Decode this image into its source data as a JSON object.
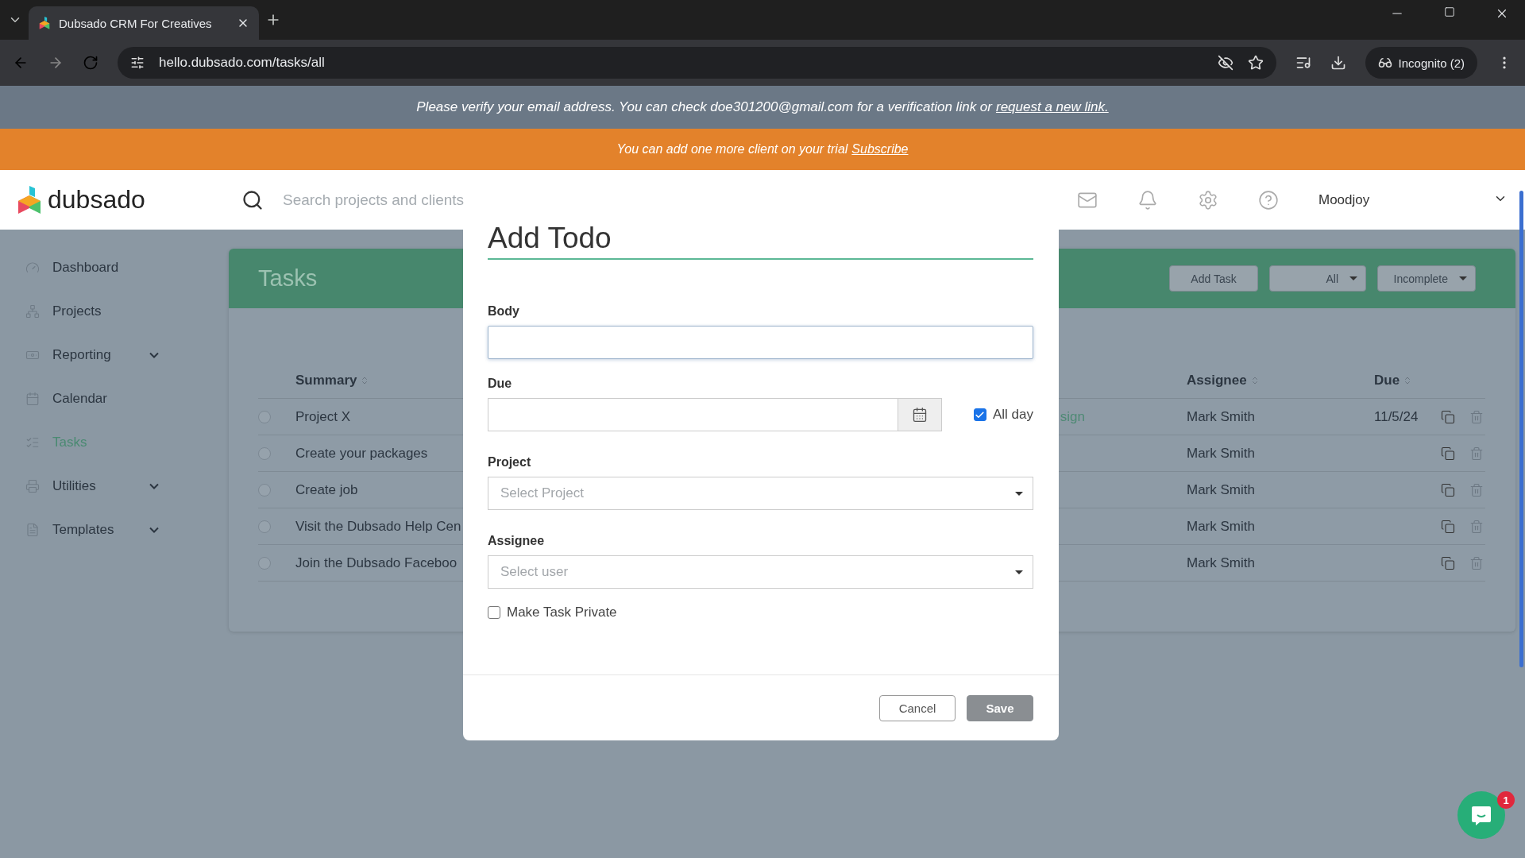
{
  "browser": {
    "tab_title": "Dubsado CRM For Creatives",
    "url": "hello.dubsado.com/tasks/all",
    "profile": "Incognito (2)"
  },
  "banners": [
    {
      "kind": "verify",
      "text": "Please verify your email address. You can check doe301200@gmail.com for a verification link or",
      "link": "request a new link."
    },
    {
      "kind": "trial",
      "text": "You can add one more client on your trial",
      "link": "Subscribe"
    }
  ],
  "header": {
    "logo": "dubsado",
    "search_placeholder": "Search projects and clients",
    "user": "Moodjoy"
  },
  "sidebar": {
    "items": [
      {
        "label": "Dashboard",
        "kind": "link",
        "selected": false
      },
      {
        "label": "Projects",
        "kind": "link",
        "selected": false
      },
      {
        "label": "Reporting",
        "kind": "group",
        "selected": false
      },
      {
        "label": "Calendar",
        "kind": "link",
        "selected": false
      },
      {
        "label": "Tasks",
        "kind": "link",
        "selected": true
      },
      {
        "label": "Utilities",
        "kind": "group",
        "selected": false
      },
      {
        "label": "Templates",
        "kind": "group",
        "selected": false
      }
    ]
  },
  "tasks": {
    "title": "Tasks",
    "add_button": "Add Task",
    "filters": [
      "All",
      "Incomplete"
    ],
    "columns": [
      "Summary",
      "Assignee",
      "Due"
    ],
    "rows": [
      {
        "summary": "Project X",
        "column_2": "sign",
        "assignee": "Mark Smith",
        "due": "11/5/24"
      },
      {
        "summary": "Create your packages",
        "assignee": "Mark Smith"
      },
      {
        "summary": "Create job",
        "assignee": "Mark Smith"
      },
      {
        "summary": "Visit the Dubsado Help Cen",
        "assignee": "Mark Smith"
      },
      {
        "summary": "Join the Dubsado Faceboo",
        "assignee": "Mark Smith"
      }
    ]
  },
  "modal": {
    "title": "Add Todo",
    "body": {
      "label": "Body",
      "focused": true
    },
    "due": {
      "label": "Due",
      "all_day": {
        "label": "All day",
        "checked": true
      }
    },
    "project": {
      "label": "Project",
      "placeholder": "Select Project"
    },
    "assignee": {
      "label": "Assignee",
      "placeholder": "Select user"
    },
    "private": {
      "label": "Make Task Private",
      "checked": false
    },
    "buttons": [
      {
        "label": "Cancel",
        "kind": "secondary"
      },
      {
        "label": "Save",
        "kind": "primary"
      }
    ]
  },
  "chat": {
    "badge": "1"
  }
}
